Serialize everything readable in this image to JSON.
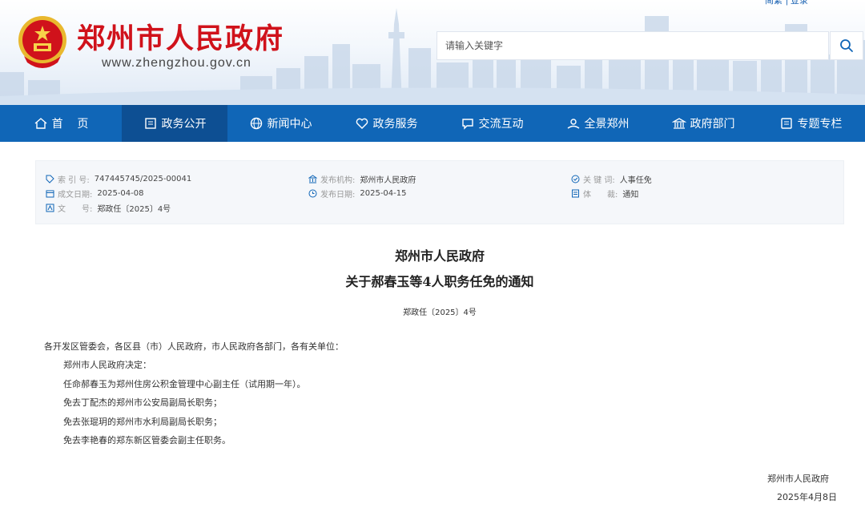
{
  "header": {
    "site_title": "郑州市人民政府",
    "site_domain": "www.zhengzhou.gov.cn",
    "top_links": [
      "简繁",
      "登录"
    ],
    "search_placeholder": "请输入关键字"
  },
  "nav": {
    "items": [
      {
        "label": "首    页",
        "icon": "home-icon"
      },
      {
        "label": "政务公开",
        "icon": "document-icon",
        "active": true
      },
      {
        "label": "新闻中心",
        "icon": "globe-icon"
      },
      {
        "label": "政务服务",
        "icon": "heart-icon"
      },
      {
        "label": "交流互动",
        "icon": "chat-icon"
      },
      {
        "label": "全景郑州",
        "icon": "panorama-icon"
      },
      {
        "label": "政府部门",
        "icon": "building-icon"
      },
      {
        "label": "专题专栏",
        "icon": "list-icon"
      }
    ]
  },
  "meta": {
    "index_label": "索 引 号:",
    "index_value": "747445745/2025-00041",
    "agency_label": "发布机构:",
    "agency_value": "郑州市人民政府",
    "keyword_label": "关 键 词:",
    "keyword_value": "人事任免",
    "created_label": "成文日期:",
    "created_value": "2025-04-08",
    "published_label": "发布日期:",
    "published_value": "2025-04-15",
    "genre_label": "体　　裁:",
    "genre_value": "通知",
    "docno_label": "文　　号:",
    "docno_value": "郑政任〔2025〕4号"
  },
  "article": {
    "title_line1": "郑州市人民政府",
    "title_line2": "关于郝春玉等4人职务任免的通知",
    "doc_number": "郑政任〔2025〕4号",
    "salutation": "各开发区管委会，各区县（市）人民政府，市人民政府各部门，各有关单位：",
    "paragraphs": [
      "郑州市人民政府决定：",
      "任命郝春玉为郑州住房公积金管理中心副主任（试用期一年）。",
      "免去丁配杰的郑州市公安局副局长职务；",
      "免去张琨玥的郑州市水利局副局长职务；",
      "免去李艳春的郑东新区管委会副主任职务。"
    ],
    "signature": "郑州市人民政府",
    "date": "2025年4月8日"
  },
  "colors": {
    "brand_red": "#d0121b",
    "nav_blue": "#1066b7",
    "nav_active": "#0d4f93"
  }
}
